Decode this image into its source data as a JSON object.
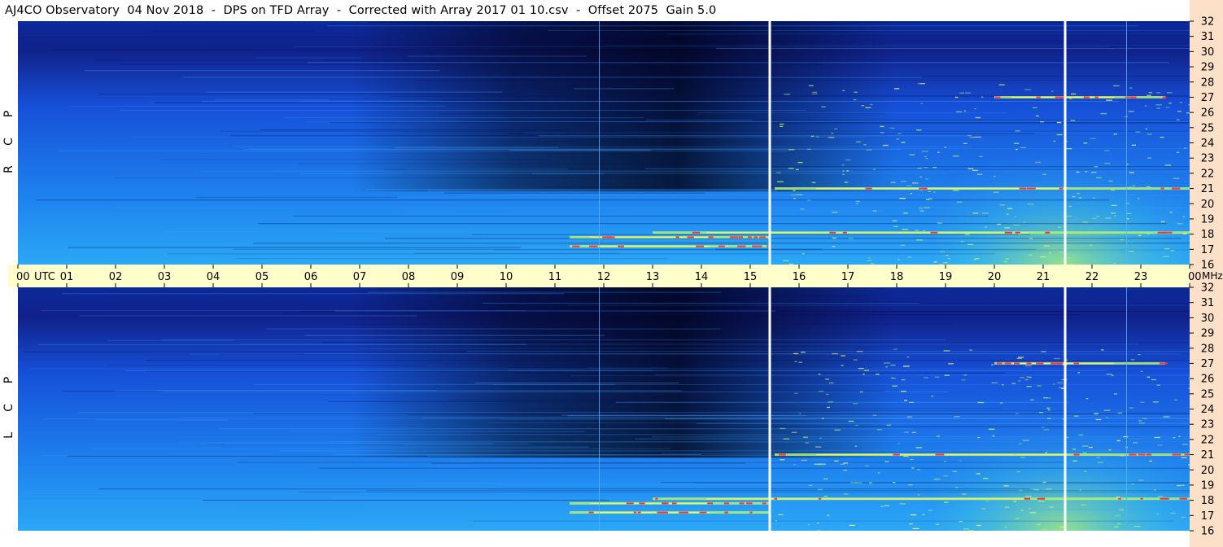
{
  "title": "AJ4CO Observatory  04 Nov 2018  -  DPS on TFD Array  -  Corrected with Array 2017 01 10.csv  -  Offset 2075  Gain 5.0",
  "panels": {
    "top_label": [
      "R",
      "C",
      "P"
    ],
    "bottom_label": [
      "L",
      "C",
      "P"
    ]
  },
  "colors": {
    "time_bar": "#ffffcc",
    "freq_strip": "#fde0c8",
    "background_low": "#0a1a8a",
    "background_mid": "#1f6cf0",
    "background_high": "#2aa8f5",
    "burst_green": "#b9f26b",
    "burst_yellow": "#f3f36a",
    "burst_red": "#ff3040",
    "marker_white": "#ffffff"
  },
  "chart_data": {
    "type": "heatmap",
    "title": "AJ4CO Observatory  04 Nov 2018  -  DPS on TFD Array  -  Corrected with Array 2017 01 10.csv  -  Offset 2075  Gain 5.0",
    "x_unit": "UTC",
    "y_unit": "MHz",
    "x_ticks": [
      "00",
      "01",
      "02",
      "03",
      "04",
      "05",
      "06",
      "07",
      "08",
      "09",
      "10",
      "11",
      "12",
      "13",
      "14",
      "15",
      "16",
      "17",
      "18",
      "19",
      "20",
      "21",
      "22",
      "23",
      "00"
    ],
    "x_range_hours": [
      0,
      24
    ],
    "y_ticks": [
      32,
      31,
      30,
      29,
      28,
      27,
      26,
      25,
      24,
      23,
      22,
      21,
      20,
      19,
      18,
      17,
      16
    ],
    "y_range_mhz": [
      16,
      32
    ],
    "panels": [
      "RCP",
      "LCP"
    ],
    "white_vertical_markers_hours": [
      15.4,
      21.45
    ],
    "thin_blue_vertical_markers_hours": [
      11.9,
      22.7
    ],
    "dark_region_hours": [
      10.8,
      16.5
    ],
    "bursts": [
      {
        "hour_start": 11.3,
        "hour_end": 15.4,
        "freq_mhz": 17.8
      },
      {
        "hour_start": 11.3,
        "hour_end": 15.4,
        "freq_mhz": 17.2
      },
      {
        "hour_start": 13.0,
        "hour_end": 24.0,
        "freq_mhz": 18.1
      },
      {
        "hour_start": 15.5,
        "hour_end": 24.0,
        "freq_mhz": 21.0
      },
      {
        "hour_start": 20.0,
        "hour_end": 23.5,
        "freq_mhz": 27.0
      }
    ]
  }
}
